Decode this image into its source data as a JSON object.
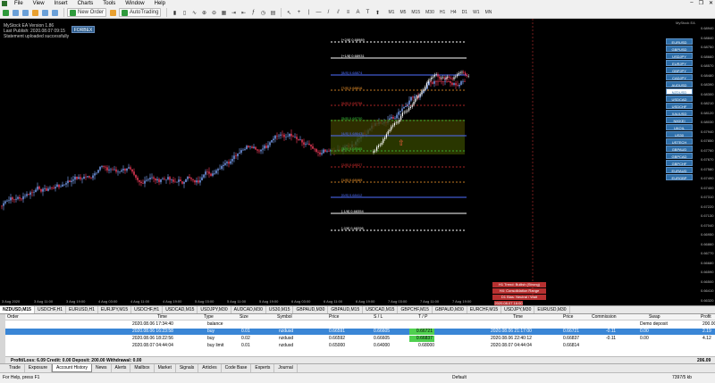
{
  "menu": {
    "items": [
      "File",
      "View",
      "Insert",
      "Charts",
      "Tools",
      "Window",
      "Help"
    ]
  },
  "toolbar": {
    "new_order": "New Order",
    "autotrading": "AutoTrading",
    "timeframes": [
      "M1",
      "M5",
      "M15",
      "M30",
      "H1",
      "H4",
      "D1",
      "W1",
      "MN"
    ]
  },
  "chart": {
    "info_lines": [
      "MyStock EA  Version 1.86",
      "Last Publish: 2020.08.07 09:15",
      "Statement uploaded successfully"
    ],
    "forbex_label": "FORBEX",
    "corner_label": "MyStock EA",
    "pairs": [
      "EURUSD",
      "GBPUSD",
      "USDJPY",
      "EURJPY",
      "GBPJPY",
      "CADJPY",
      "AUDUSD",
      "NZDUSD",
      "USDCAD",
      "USDCHF",
      "XAUUSD",
      "NIKKEI",
      "UKOIL",
      "US30",
      "USTECH",
      "GBPAUD",
      "GBPCAD",
      "GBPCHF",
      "EURAUD",
      "EURGBP"
    ],
    "selected_pair": "NZDUSD",
    "y_ticks": [
      "0.68940",
      "0.68840",
      "0.68750",
      "0.68660",
      "0.68570",
      "0.68480",
      "0.68390",
      "0.68300",
      "0.68210",
      "0.68120",
      "0.68030",
      "0.67940",
      "0.67850",
      "0.67760",
      "0.67670",
      "0.67580",
      "0.67490",
      "0.67400",
      "0.67310",
      "0.67220",
      "0.67130",
      "0.67040",
      "0.66950",
      "0.66860",
      "0.66770",
      "0.66680",
      "0.66590",
      "0.66500",
      "0.66410",
      "0.66320"
    ],
    "x_ticks": [
      "3 Aug 2020",
      "3 Aug 11:00",
      "3 Aug 19:00",
      "4 Aug 03:00",
      "4 Aug 11:00",
      "4 Aug 19:00",
      "5 Aug 03:00",
      "5 Aug 11:00",
      "5 Aug 19:00",
      "6 Aug 03:00",
      "6 Aug 11:00",
      "6 Aug 19:00",
      "7 Aug 03:00",
      "7 Aug 11:00",
      "7 Aug 19:00"
    ],
    "levels": [
      {
        "label": "[+2/8]  0.68989",
        "color": "#ffffff"
      },
      {
        "label": "[+1/8]  0.68931",
        "color": "#ffffff"
      },
      {
        "label": "[8/8]  0.68874",
        "color": "#4f6fff"
      },
      {
        "label": "[7/8]  0.68816",
        "color": "#ff9e2e"
      },
      {
        "label": "[6/8]  0.68758",
        "color": "#e03030"
      },
      {
        "label": "[5/8]  0.68700",
        "color": "#3fcf3f"
      },
      {
        "label": "[4/8]  0.68643",
        "color": "#4f6fff"
      },
      {
        "label": "[3/8]  0.68585",
        "color": "#3fcf3f"
      },
      {
        "label": "[2/8]  0.68527",
        "color": "#e03030"
      },
      {
        "label": "[1/8]  0.68469",
        "color": "#ff9e2e"
      },
      {
        "label": "[0/8]  0.68412",
        "color": "#4f6fff"
      },
      {
        "label": "[-1/8]  0.68354",
        "color": "#ffffff"
      },
      {
        "label": "[-2/8]  0.68296",
        "color": "#ffffff"
      }
    ],
    "red_boxes": [
      "H1 Trend: Bullish (Strong)",
      "H4: Consolidation Range",
      "D1 Bias: Neutral / Wait",
      "2020.08.07 16:00"
    ]
  },
  "chart_tabs": [
    {
      "label": "NZDUSD,M15",
      "active": true
    },
    {
      "label": "USDCHF,H1"
    },
    {
      "label": "EURUSD,H1"
    },
    {
      "label": "EURJPY,M15"
    },
    {
      "label": "USDCHF,H1"
    },
    {
      "label": "USDCAD,M15"
    },
    {
      "label": "USDJPY,M30"
    },
    {
      "label": "AUDCAD,M30"
    },
    {
      "label": "US30,M15"
    },
    {
      "label": "GBPAUD,M30"
    },
    {
      "label": "GBPAUD,M15"
    },
    {
      "label": "USDCAD,M15"
    },
    {
      "label": "GBPCHF,M15"
    },
    {
      "label": "GBPAUD,M30"
    },
    {
      "label": "EURCHF,M15"
    },
    {
      "label": "USDJPY,M30"
    },
    {
      "label": "EURUSD,M30"
    }
  ],
  "terminal": {
    "headers": {
      "order": "Order",
      "time": "Time",
      "type": "Type",
      "size": "Size",
      "symbol": "Symbol",
      "price": "Price",
      "sl": "S / L",
      "tp": "T / P",
      "time2": "Time",
      "price2": "Price",
      "commission": "Commission",
      "swap": "Swap",
      "profit": "Profit"
    },
    "rows": [
      {
        "time": "2020.08.06 17:34:40",
        "type": "balance",
        "size": "",
        "symbol": "",
        "price": "",
        "sl": "",
        "tp": "",
        "time2": "",
        "price2": "",
        "commission": "",
        "swap": "Demo deposit",
        "profit": "200.00",
        "selected": false
      },
      {
        "time": "2020.08.06 16:23:58",
        "type": "buy",
        "size": "0.01",
        "symbol": "nzdusd",
        "price": "0.66591",
        "sl": "0.66605",
        "tp": "0.66721",
        "time2": "2020.08.06 21:17:00",
        "price2": "0.66721",
        "commission": "-0.11",
        "swap": "0.00",
        "profit": "2.19",
        "selected": true
      },
      {
        "time": "2020.08.06 18:22:56",
        "type": "buy",
        "size": "0.02",
        "symbol": "nzdusd",
        "price": "0.66592",
        "sl": "0.66605",
        "tp": "0.66837",
        "time2": "2020.08.06 22:40:12",
        "price2": "0.66837",
        "commission": "-0.11",
        "swap": "0.00",
        "profit": "4.12",
        "selected": false
      },
      {
        "time": "2020.08.07 04:44:04",
        "type": "buy limit",
        "size": "0.01",
        "symbol": "nzdusd",
        "price": "0.65000",
        "sl": "0.64000",
        "tp": "0.68000",
        "time2": "2020.08.07 04:44:04",
        "price2": "0.66814",
        "commission": "",
        "swap": "",
        "profit": "",
        "selected": false
      }
    ],
    "summary": "Profit/Loss: 6.09  Credit: 0.00  Deposit: 200.00  Withdrawal: 0.00",
    "summary_total": "206.09"
  },
  "terminal_tabs": [
    "Trade",
    "Exposure",
    "Account History",
    "News",
    "Alerts",
    "Mailbox",
    "Market",
    "Signals",
    "Articles",
    "Code Base",
    "Experts",
    "Journal"
  ],
  "active_terminal_tab": "Account History",
  "status": {
    "help": "For Help, press F1",
    "profile": "Default",
    "traffic": "7397/5 kb"
  }
}
